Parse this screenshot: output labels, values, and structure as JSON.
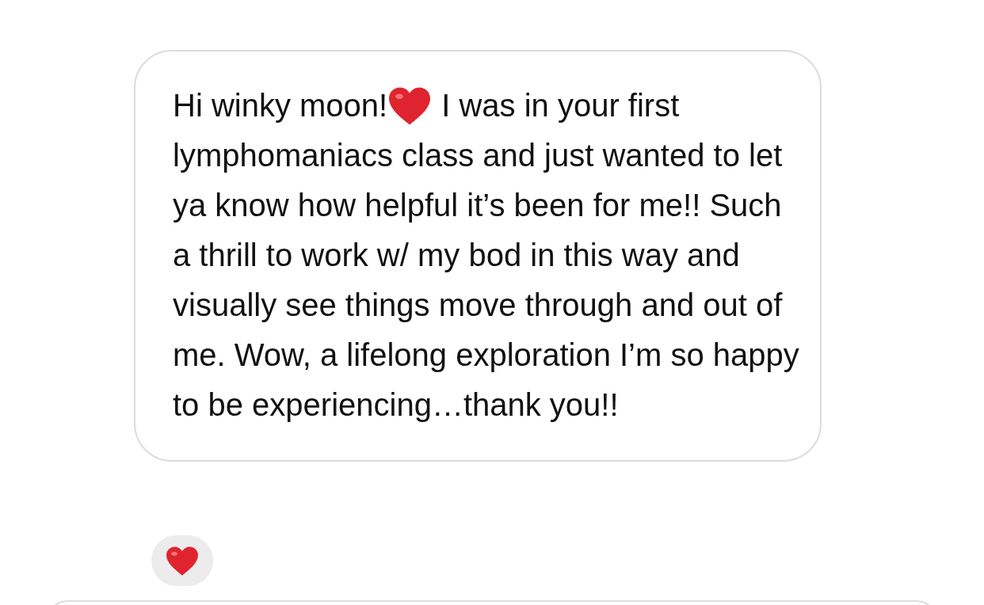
{
  "message": {
    "greeting": "Hi winky moon!",
    "first_line": "I was in your first",
    "text": "lymphomaniacs class and just wanted to let ya know how helpful it’s been for me!! Such a thrill to work w/ my bod in this way and visually see things move through and out of me. Wow, a lifelong exploration I’m so happy to be experiencing…thank you!!"
  }
}
